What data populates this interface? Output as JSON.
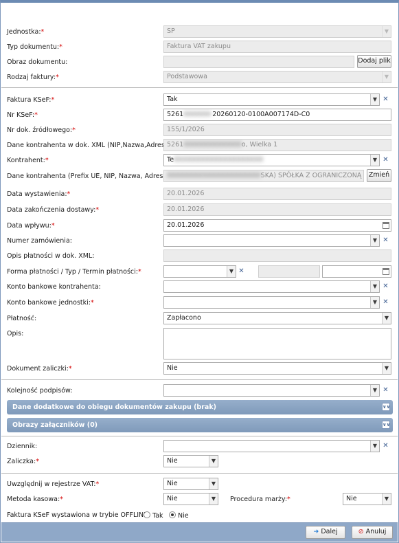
{
  "form": {
    "jednostka": {
      "label": "Jednostka:",
      "value": "SP"
    },
    "typ_dokumentu": {
      "label": "Typ dokumentu:",
      "value": "Faktura VAT zakupu"
    },
    "obraz_dokumentu": {
      "label": "Obraz dokumentu:",
      "button": "Dodaj plik"
    },
    "rodzaj_faktury": {
      "label": "Rodzaj faktury:",
      "value": "Podstawowa"
    },
    "faktura_ksef": {
      "label": "Faktura KSeF:",
      "value": "Tak"
    },
    "nr_ksef": {
      "label": "Nr KSeF:",
      "value_prefix": "5261",
      "value_hidden": "XXXXXX-",
      "value_suffix": "20260120-0100A007174D-C0"
    },
    "nr_dok_zrodlowego": {
      "label": "Nr dok. źródłowego:",
      "value": "155/1/2026"
    },
    "dane_kontrahenta_xml": {
      "label": "Dane kontrahenta w dok. XML (NIP,Nazwa,Adres):",
      "value_prefix": "5261",
      "value_hidden": "XXXXXXXXXXXXX",
      "value_suffix": "o, Wielka 1"
    },
    "kontrahent": {
      "label": "Kontrahent:",
      "value": "Te",
      "value_hidden": "XXXXXXXXXXXXXXXXXXXX"
    },
    "dane_kontrahenta_prefix": {
      "label": "Dane kontrahenta (Prefix UE, NIP, Nazwa, Adres):",
      "value_hidden": "XXXXXXXXXXXXXXXXXXXXX",
      "value_suffix": "SKA) SPÓŁKA Z OGRANICZONĄ ODPOWI",
      "button": "Zmień"
    },
    "data_wystawienia": {
      "label": "Data wystawienia:",
      "value": "20.01.2026"
    },
    "data_zakonczenia_dostawy": {
      "label": "Data zakończenia dostawy:",
      "value": "20.01.2026"
    },
    "data_wplywu": {
      "label": "Data wpływu:",
      "value": "20.01.2026"
    },
    "numer_zamowienia": {
      "label": "Numer zamówienia:",
      "value": ""
    },
    "opis_platnosci": {
      "label": "Opis płatności w dok. XML:",
      "value": ""
    },
    "forma_platnosci": {
      "label": "Forma płatności / Typ / Termin płatności:",
      "value": "",
      "typ": "",
      "termin": ""
    },
    "konto_kontrahenta": {
      "label": "Konto bankowe kontrahenta:",
      "value": ""
    },
    "konto_jednostki": {
      "label": "Konto bankowe jednostki:",
      "value": ""
    },
    "platnosc": {
      "label": "Płatność:",
      "value": "Zapłacono"
    },
    "opis": {
      "label": "Opis:",
      "value": ""
    },
    "dokument_zaliczki": {
      "label": "Dokument zaliczki:",
      "value": "Nie"
    },
    "kolejnosc_podpisow": {
      "label": "Kolejność podpisów:",
      "value": ""
    },
    "dziennik": {
      "label": "Dziennik:",
      "value": ""
    },
    "zaliczka": {
      "label": "Zaliczka:",
      "value": "Nie"
    },
    "rejestr_vat": {
      "label": "Uwzględnij w rejestrze VAT:",
      "value": "Nie"
    },
    "metoda_kasowa": {
      "label": "Metoda kasowa:",
      "value": "Nie"
    },
    "procedura_marzy": {
      "label": "Procedura marży:",
      "value": "Nie"
    },
    "offline": {
      "label": "Faktura KSeF wystawiona w trybie OFFLINE:",
      "opt_tak": "Tak",
      "opt_nie": "Nie",
      "selected": "Nie"
    }
  },
  "sections": {
    "dane_dodatkowe": "Dane dodatkowe do obiegu dokumentów zakupu (brak)",
    "obrazy_zalacznikow": "Obrazy załączników (0)"
  },
  "footer": {
    "next": "Dalej",
    "cancel": "Anuluj"
  },
  "required_mark": "*",
  "colors": {
    "accent": "#8fa8c8",
    "required": "#d40000",
    "readonly_bg": "#ececec"
  },
  "icons": {
    "dropdown": "chevron-down-icon",
    "clear": "clear-x-icon",
    "calendar": "calendar-icon",
    "next": "arrow-right-icon",
    "cancel": "cancel-icon"
  }
}
